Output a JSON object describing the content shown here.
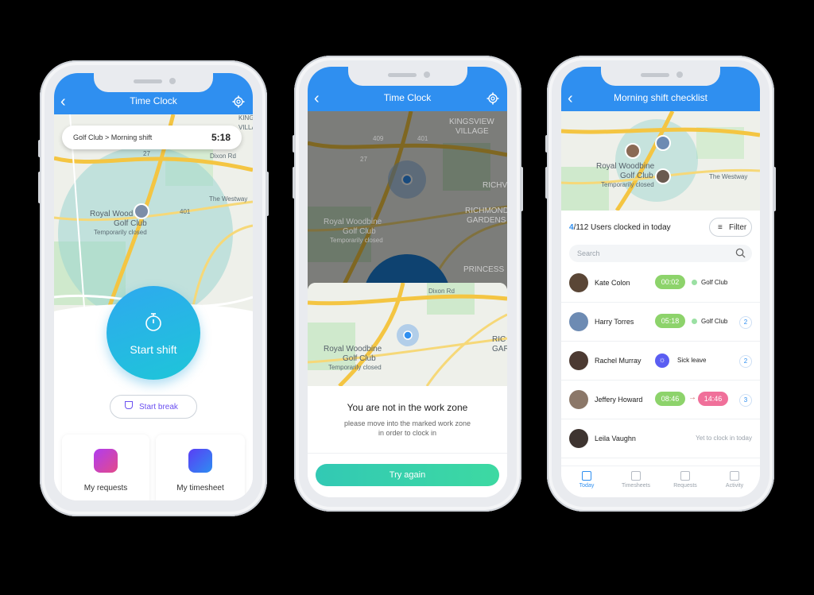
{
  "colors": {
    "accent": "#2f8ff0",
    "green": "#7fd36f",
    "pink": "#f0709a",
    "teal": "#34cfae"
  },
  "phone1": {
    "title": "Time Clock",
    "back_icon": "‹",
    "location_pill": {
      "label": "Golf Club > Morning shift",
      "time": "5:18"
    },
    "map_labels": {
      "place": "Royal Wood",
      "place2": "Golf Club",
      "closed": "Temporarily closed",
      "n1": "KINGS",
      "n2": "VILLA",
      "road": "Dixon Rd",
      "road2": "The Westway",
      "r1": "409",
      "r2": "27",
      "r3": "401"
    },
    "start_shift": "Start shift",
    "start_break": "Start break",
    "cards": [
      {
        "label": "My requests"
      },
      {
        "label": "My timesheet"
      }
    ]
  },
  "phone2": {
    "title": "Time Clock",
    "back_icon": "‹",
    "map_labels": {
      "n1": "KINGSVIEW",
      "n2": "VILLAGE",
      "richmond": "RICHMOND",
      "gardens": "GARDENS",
      "princess": "PRINCESS",
      "richv": "RICHV",
      "place": "Royal Woodbine",
      "place2": "Golf Club",
      "closed": "Temporarily closed",
      "road": "Dixon Rd",
      "ric": "RIC",
      "gar": "GAR",
      "r1": "409",
      "r2": "27",
      "r3": "401"
    },
    "message_title": "You are not in the work zone",
    "message_body_1": "please move into the marked work zone",
    "message_body_2": "in order to clock in",
    "try_again": "Try again"
  },
  "phone3": {
    "title": "Morning shift checklist",
    "back_icon": "‹",
    "map_labels": {
      "place": "Royal Woodbine",
      "place2": "Golf Club",
      "closed": "Temporarily closed",
      "road": "The Westway"
    },
    "count": "4",
    "total": "/112 Users clocked in today",
    "filter": "Filter",
    "search_placeholder": "Search",
    "rows": [
      {
        "name": "Kate Colon",
        "time": "00:02",
        "location": "Golf Club",
        "badge": ""
      },
      {
        "name": "Harry Torres",
        "time": "05:18",
        "location": "Golf Club",
        "badge": "2"
      },
      {
        "name": "Rachel Murray",
        "status": "Sick leave",
        "badge": "2"
      },
      {
        "name": "Jeffery Howard",
        "time": "08:46",
        "time_out": "14:46",
        "badge": "3"
      },
      {
        "name": "Leila Vaughn",
        "status": "Yet to clock in today"
      }
    ],
    "tabs": [
      "Today",
      "Timesheets",
      "Requests",
      "Activity"
    ]
  }
}
